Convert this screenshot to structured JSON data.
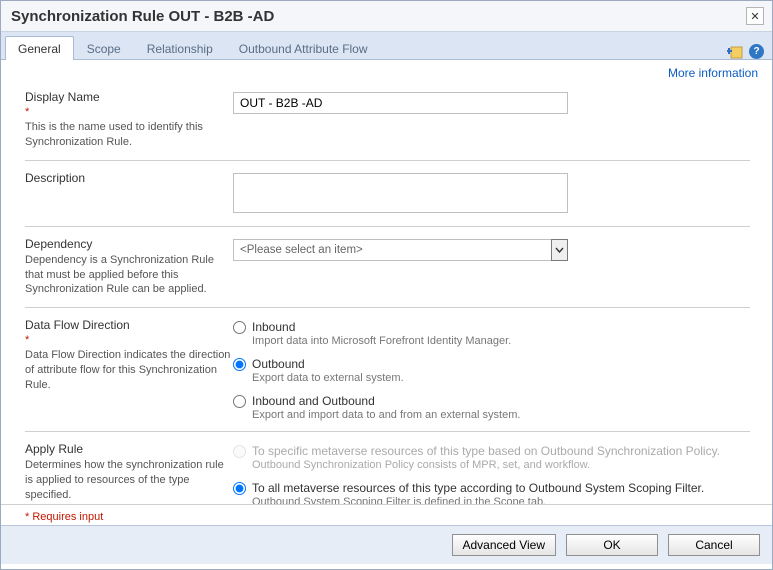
{
  "window": {
    "title": "Synchronization Rule OUT - B2B -AD",
    "close_glyph": "✕"
  },
  "tabs": [
    {
      "label": "General",
      "active": true
    },
    {
      "label": "Scope",
      "active": false
    },
    {
      "label": "Relationship",
      "active": false
    },
    {
      "label": "Outbound Attribute Flow",
      "active": false
    }
  ],
  "help": {
    "glyph": "?"
  },
  "more_info": "More information",
  "form": {
    "displayName": {
      "label": "Display Name",
      "required_marker": "*",
      "desc": "This is the name used to identify this Synchronization Rule.",
      "value": "OUT - B2B -AD"
    },
    "description": {
      "label": "Description",
      "value": ""
    },
    "dependency": {
      "label": "Dependency",
      "desc": "Dependency is a Synchronization Rule that must be applied before this Synchronization Rule can be applied.",
      "placeholder": "<Please select an item>"
    },
    "dataFlow": {
      "label": "Data Flow Direction",
      "required_marker": "*",
      "desc": "Data Flow Direction indicates the direction of attribute flow for this Synchronization Rule.",
      "options": [
        {
          "title": "Inbound",
          "sub": "Import data into Microsoft Forefront Identity Manager."
        },
        {
          "title": "Outbound",
          "sub": "Export data to external system."
        },
        {
          "title": "Inbound and Outbound",
          "sub": "Export and import data to and from an external system."
        }
      ],
      "selected": 1
    },
    "applyRule": {
      "label": "Apply Rule",
      "desc": "Determines how the synchronization rule is applied to resources of the type specified.",
      "options": [
        {
          "title": "To specific metaverse resources of this type based on Outbound Synchronization Policy.",
          "sub": "Outbound Synchronization Policy consists of MPR, set, and workflow.",
          "disabled": true
        },
        {
          "title": "To all metaverse resources of this type according to Outbound System Scoping Filter.",
          "sub": "Outbound System Scoping Filter is defined in the Scope tab.",
          "disabled": false
        }
      ],
      "selected": 1
    },
    "requires_note": "* Requires input"
  },
  "footer": {
    "advanced": "Advanced View",
    "ok": "OK",
    "cancel": "Cancel"
  }
}
